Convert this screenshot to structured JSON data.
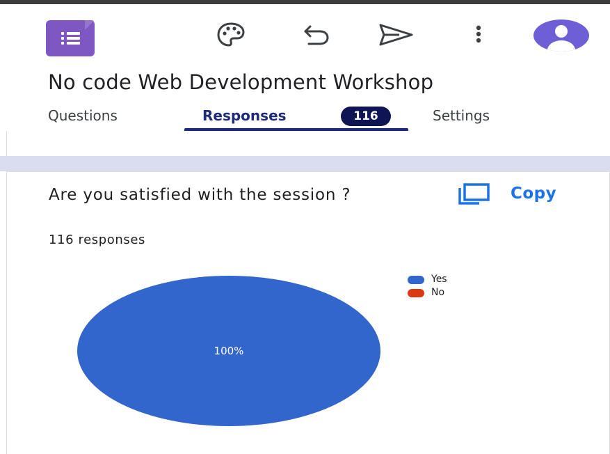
{
  "toolbar": {
    "icons": [
      "forms-app-icon",
      "palette-icon",
      "undo-icon",
      "send-icon",
      "more-vert-icon",
      "account-avatar"
    ],
    "accent": "#7e57c2"
  },
  "form": {
    "title": "No code Web Development Workshop"
  },
  "tabs": [
    {
      "label": "Questions",
      "active": false
    },
    {
      "label": "Responses",
      "active": true,
      "badge": "116"
    },
    {
      "label": "Settings",
      "active": false
    }
  ],
  "question_card": {
    "title": "Are you satisfied with the session ?",
    "copy_label": "Copy",
    "response_count": "116 responses"
  },
  "chart_data": {
    "type": "pie",
    "categories": [
      "Yes",
      "No"
    ],
    "values": [
      100,
      0
    ],
    "colors": [
      "#3366cc",
      "#dc3912"
    ],
    "data_labels": [
      "100%"
    ],
    "legend_position": "top-right"
  }
}
